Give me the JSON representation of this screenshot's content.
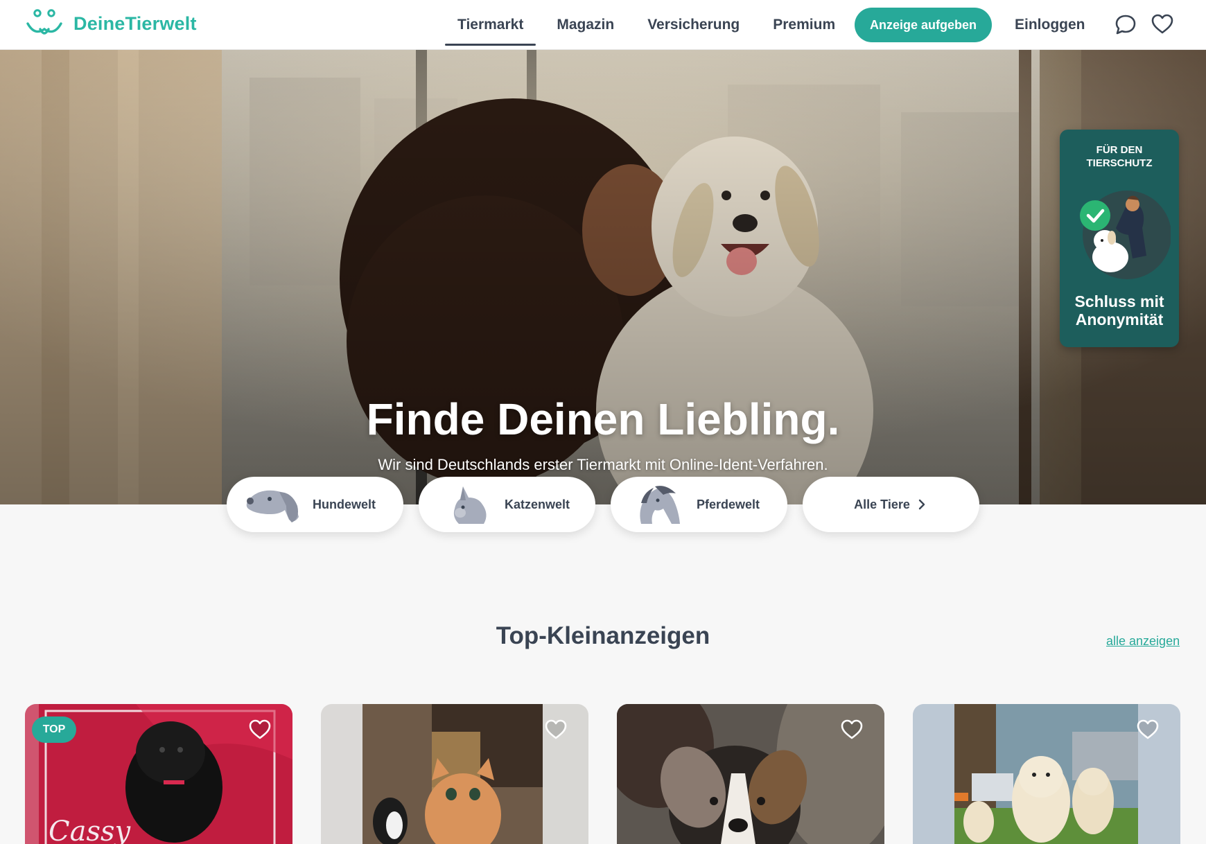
{
  "brand": {
    "name": "DeineTierwelt",
    "accent": "#27a999",
    "logo_icon": "pet-face-logo-icon"
  },
  "nav": {
    "items": [
      {
        "label": "Tiermarkt",
        "active": true
      },
      {
        "label": "Magazin",
        "active": false
      },
      {
        "label": "Versicherung",
        "active": false
      },
      {
        "label": "Premium",
        "active": false
      }
    ],
    "cta_label": "Anzeige aufgeben",
    "login_label": "Einloggen",
    "icons": [
      "chat-bubble-icon",
      "heart-icon"
    ]
  },
  "hero": {
    "title": "Finde Deinen Liebling.",
    "subtitle": "Wir sind Deutschlands erster Tiermarkt mit Online-Ident-Verfahren."
  },
  "badge": {
    "top_line1": "FÜR DEN",
    "top_line2": "TIERSCHUTZ",
    "bottom_line1": "Schluss mit",
    "bottom_line2": "Anonymität",
    "icon": "check-icon"
  },
  "categories": [
    {
      "label": "Hundewelt",
      "icon": "dog-head-icon"
    },
    {
      "label": "Katzenwelt",
      "icon": "cat-head-icon"
    },
    {
      "label": "Pferdewelt",
      "icon": "horse-head-icon"
    },
    {
      "label": "Alle Tiere",
      "icon": "chevron-right-icon"
    }
  ],
  "listings": {
    "title": "Top-Kleinanzeigen",
    "see_all_label": "alle anzeigen",
    "cards": [
      {
        "badge": "TOP",
        "photo_caption": "Cassy",
        "subject": "black poodle puppy"
      },
      {
        "subject": "kittens"
      },
      {
        "subject": "tricolor puppy"
      },
      {
        "subject": "golden retriever puppies"
      }
    ]
  }
}
